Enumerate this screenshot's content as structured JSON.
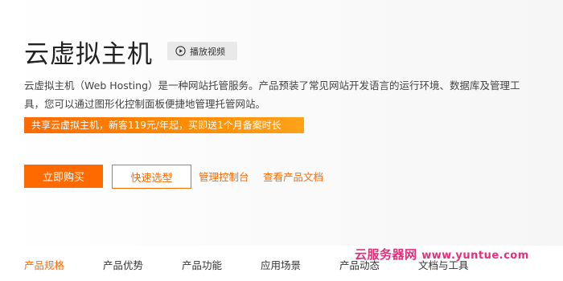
{
  "header": {
    "title": "云虚拟主机",
    "play_button_label": "播放视频"
  },
  "description": "云虚拟主机（Web Hosting）是一种网站托管服务。产品预装了常见网站开发语言的运行环境、数据库及管理工具，您可以通过图形化控制面板便捷地管理托管网站。",
  "promo_banner": "共享云虚拟主机，新客119元/年起，买即送1个月备案时长",
  "actions": {
    "buy_label": "立即购买",
    "quick_select_label": "快速选型",
    "console_link": "管理控制台",
    "docs_link": "查看产品文档"
  },
  "watermark": {
    "text": "云服务器网",
    "url": "www.yuntue.com"
  },
  "tabs": [
    {
      "label": "产品规格",
      "active": true
    },
    {
      "label": "产品优势",
      "active": false
    },
    {
      "label": "产品功能",
      "active": false
    },
    {
      "label": "应用场景",
      "active": false
    },
    {
      "label": "产品动态",
      "active": false
    },
    {
      "label": "文档与工具",
      "active": false
    }
  ],
  "colors": {
    "accent": "#ff6a00",
    "watermark": "#e62e7a"
  },
  "icons": {
    "play": "play-circle-icon"
  }
}
